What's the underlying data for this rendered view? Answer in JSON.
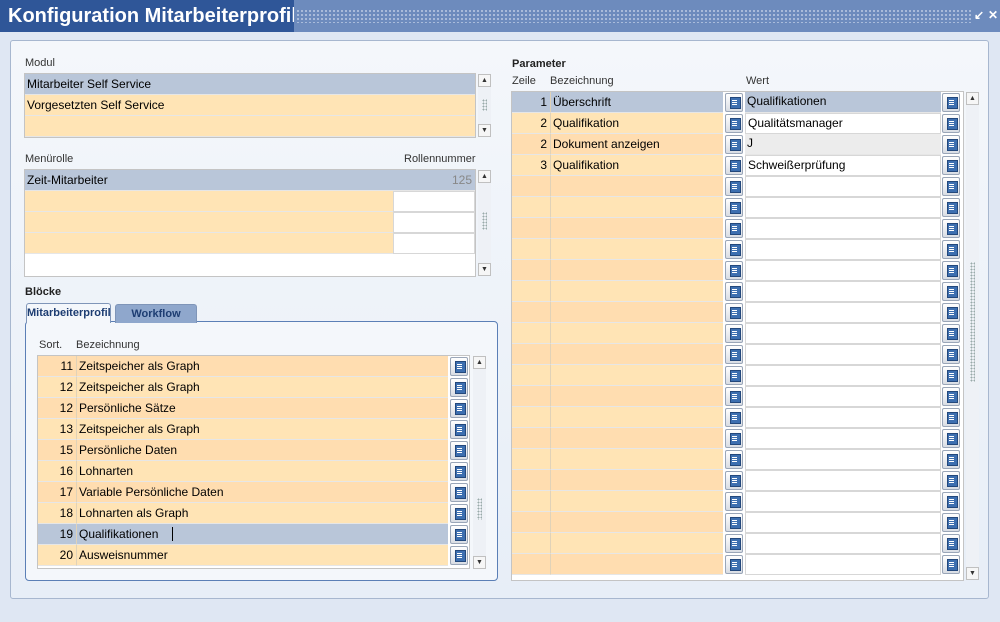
{
  "window": {
    "title": "Konfiguration Mitarbeiterprofil",
    "minimize_icon": "restore-arrow-icon",
    "close_icon": "close-icon"
  },
  "modul": {
    "label": "Modul",
    "rows": [
      "Mitarbeiter Self Service",
      "Vorgesetzten Self Service",
      ""
    ]
  },
  "menuerolle": {
    "label": "Menürolle",
    "number_label": "Rollennummer",
    "rows": [
      {
        "name": "Zeit-Mitarbeiter",
        "number": "125"
      },
      {
        "name": "",
        "number": ""
      },
      {
        "name": "",
        "number": ""
      },
      {
        "name": "",
        "number": ""
      }
    ]
  },
  "bloecke": {
    "label": "Blöcke",
    "tabs": [
      "Mitarbeiterprofil",
      "Workflow"
    ],
    "col_sort": "Sort.",
    "col_name": "Bezeichnung",
    "rows": [
      {
        "sort": "11",
        "name": "Zeitspeicher als Graph"
      },
      {
        "sort": "12",
        "name": "Zeitspeicher als Graph"
      },
      {
        "sort": "12",
        "name": "Persönliche Sätze"
      },
      {
        "sort": "13",
        "name": "Zeitspeicher als Graph"
      },
      {
        "sort": "15",
        "name": "Persönliche Daten"
      },
      {
        "sort": "16",
        "name": "Lohnarten"
      },
      {
        "sort": "17",
        "name": "Variable Persönliche Daten"
      },
      {
        "sort": "18",
        "name": "Lohnarten als Graph"
      },
      {
        "sort": "19",
        "name": "Qualifikationen"
      },
      {
        "sort": "20",
        "name": "Ausweisnummer"
      }
    ]
  },
  "parameter": {
    "label": "Parameter",
    "col_zeile": "Zeile",
    "col_name": "Bezeichnung",
    "col_wert": "Wert",
    "rows": [
      {
        "zeile": "1",
        "name": "Überschrift",
        "wert": "Qualifikationen"
      },
      {
        "zeile": "2",
        "name": "Qualifikation",
        "wert": "Qualitätsmanager"
      },
      {
        "zeile": "2",
        "name": "Dokument anzeigen",
        "wert": "J"
      },
      {
        "zeile": "3",
        "name": "Qualifikation",
        "wert": "Schweißerprüfung"
      },
      {
        "zeile": "",
        "name": "",
        "wert": ""
      },
      {
        "zeile": "",
        "name": "",
        "wert": ""
      },
      {
        "zeile": "",
        "name": "",
        "wert": ""
      },
      {
        "zeile": "",
        "name": "",
        "wert": ""
      },
      {
        "zeile": "",
        "name": "",
        "wert": ""
      },
      {
        "zeile": "",
        "name": "",
        "wert": ""
      },
      {
        "zeile": "",
        "name": "",
        "wert": ""
      },
      {
        "zeile": "",
        "name": "",
        "wert": ""
      },
      {
        "zeile": "",
        "name": "",
        "wert": ""
      },
      {
        "zeile": "",
        "name": "",
        "wert": ""
      },
      {
        "zeile": "",
        "name": "",
        "wert": ""
      },
      {
        "zeile": "",
        "name": "",
        "wert": ""
      },
      {
        "zeile": "",
        "name": "",
        "wert": ""
      },
      {
        "zeile": "",
        "name": "",
        "wert": ""
      },
      {
        "zeile": "",
        "name": "",
        "wert": ""
      },
      {
        "zeile": "",
        "name": "",
        "wert": ""
      },
      {
        "zeile": "",
        "name": "",
        "wert": ""
      },
      {
        "zeile": "",
        "name": "",
        "wert": ""
      },
      {
        "zeile": "",
        "name": "",
        "wert": ""
      }
    ]
  },
  "colors": {
    "title_bg": "#2f5698",
    "selected_row": "#b9c6d9",
    "record_row": "#ffe4b5"
  }
}
